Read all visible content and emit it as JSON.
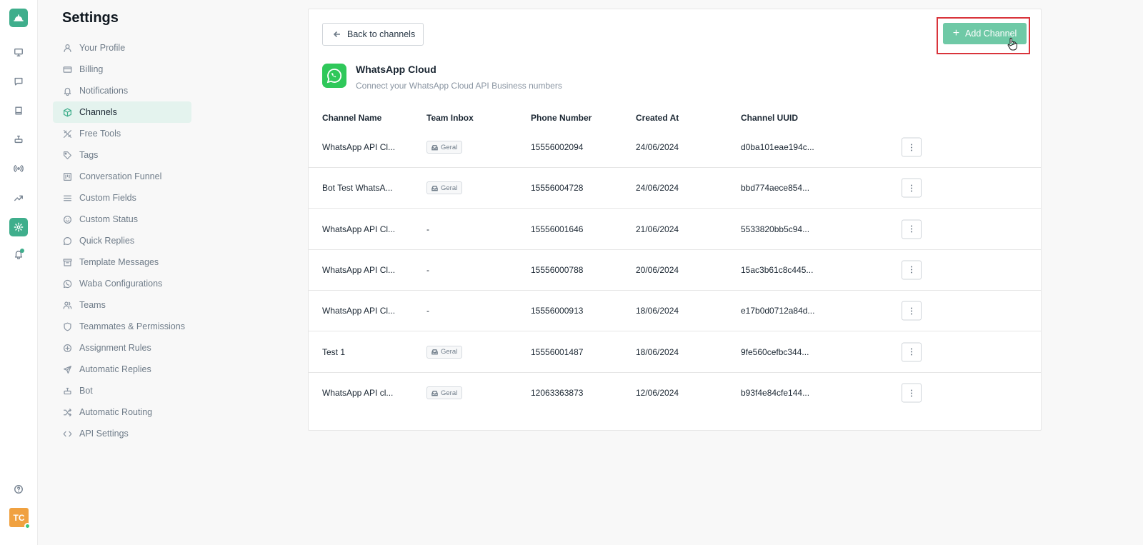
{
  "rail": {
    "items": [
      {
        "icon": "monitor-icon"
      },
      {
        "icon": "chat-icon"
      },
      {
        "icon": "book-icon"
      },
      {
        "icon": "bot-icon"
      },
      {
        "icon": "broadcast-icon"
      },
      {
        "icon": "trend-icon"
      },
      {
        "icon": "settings-gear-icon",
        "active": true
      },
      {
        "icon": "bell-icon",
        "dot": true
      }
    ],
    "help_icon": "help-circle-icon",
    "avatar_initials": "TC"
  },
  "settings": {
    "title": "Settings",
    "nav": [
      {
        "label": "Your Profile",
        "icon": "user-icon"
      },
      {
        "label": "Billing",
        "icon": "credit-card-icon"
      },
      {
        "label": "Notifications",
        "icon": "bell-icon"
      },
      {
        "label": "Channels",
        "icon": "cube-icon",
        "active": true
      },
      {
        "label": "Free Tools",
        "icon": "tools-icon"
      },
      {
        "label": "Tags",
        "icon": "tag-icon"
      },
      {
        "label": "Conversation Funnel",
        "icon": "funnel-board-icon"
      },
      {
        "label": "Custom Fields",
        "icon": "list-icon"
      },
      {
        "label": "Custom Status",
        "icon": "smile-icon"
      },
      {
        "label": "Quick Replies",
        "icon": "message-icon"
      },
      {
        "label": "Template Messages",
        "icon": "archive-icon"
      },
      {
        "label": "Waba Configurations",
        "icon": "whatsapp-icon"
      },
      {
        "label": "Teams",
        "icon": "users-icon"
      },
      {
        "label": "Teammates & Permissions",
        "icon": "shield-icon"
      },
      {
        "label": "Assignment Rules",
        "icon": "plus-circle-icon"
      },
      {
        "label": "Automatic Replies",
        "icon": "send-icon"
      },
      {
        "label": "Bot",
        "icon": "bot-icon"
      },
      {
        "label": "Automatic Routing",
        "icon": "shuffle-icon"
      },
      {
        "label": "API Settings",
        "icon": "code-icon"
      }
    ]
  },
  "channel_page": {
    "back_label": "Back to channels",
    "add_label": "Add Channel",
    "title": "WhatsApp Cloud",
    "subtitle": "Connect your WhatsApp Cloud API Business numbers",
    "columns": [
      "Channel Name",
      "Team Inbox",
      "Phone Number",
      "Created At",
      "Channel UUID"
    ],
    "rows": [
      {
        "name": "WhatsApp API Cl...",
        "inbox": "Geral",
        "phone": "15556002094",
        "created": "24/06/2024",
        "uuid": "d0ba101eae194c..."
      },
      {
        "name": "Bot Test WhatsA...",
        "inbox": "Geral",
        "phone": "15556004728",
        "created": "24/06/2024",
        "uuid": "bbd774aece854..."
      },
      {
        "name": "WhatsApp API Cl...",
        "inbox": "-",
        "phone": "15556001646",
        "created": "21/06/2024",
        "uuid": "5533820bb5c94..."
      },
      {
        "name": "WhatsApp API Cl...",
        "inbox": "-",
        "phone": "15556000788",
        "created": "20/06/2024",
        "uuid": "15ac3b61c8c445..."
      },
      {
        "name": "WhatsApp API Cl...",
        "inbox": "-",
        "phone": "15556000913",
        "created": "18/06/2024",
        "uuid": "e17b0d0712a84d..."
      },
      {
        "name": "Test 1",
        "inbox": "Geral",
        "phone": "15556001487",
        "created": "18/06/2024",
        "uuid": "9fe560cefbc344..."
      },
      {
        "name": "WhatsApp API cl...",
        "inbox": "Geral",
        "phone": "12063363873",
        "created": "12/06/2024",
        "uuid": "b93f4e84cfe144..."
      }
    ]
  },
  "colors": {
    "accent": "#3fae8c",
    "add_button": "#6fc9a6",
    "highlight_border": "#d9343b"
  }
}
